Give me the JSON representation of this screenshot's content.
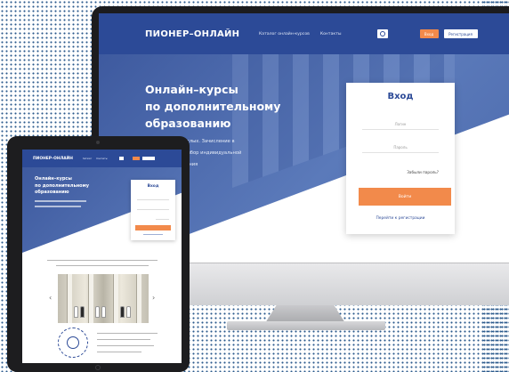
{
  "desktop": {
    "logo": "ПИОНЕР–ОНЛАЙН",
    "nav_links": [
      "Каталог онлайн-курсов",
      "Контакты"
    ],
    "btn_login": "Вход",
    "btn_register": "Регистрация",
    "hero_title_1": "Онлайн–курсы",
    "hero_title_2": "по дополнительному",
    "hero_title_3": "образованию",
    "hero_desc_1": "для детей и взрослых. Зачисление в",
    "hero_desc_2": "сертификаты и выбор индивидуальной",
    "hero_desc_3": "траектории обучения",
    "login": {
      "title": "Вход",
      "login_placeholder": "Логин",
      "password_placeholder": "Пароль",
      "forgot": "Забыли пароль?",
      "submit": "Войти",
      "register_link": "Перейти к регистрации"
    }
  },
  "tablet": {
    "logo": "ПИОНЕР–ОНЛАЙН",
    "nav_links": [
      "Каталог",
      "Контакты"
    ],
    "hero_title_1": "Онлайн–курсы",
    "hero_title_2": "по дополнительному",
    "hero_title_3": "образованию",
    "login_title": "Вход"
  },
  "colors": {
    "brand_blue": "#2c4a97",
    "accent_orange": "#f28a4b"
  }
}
